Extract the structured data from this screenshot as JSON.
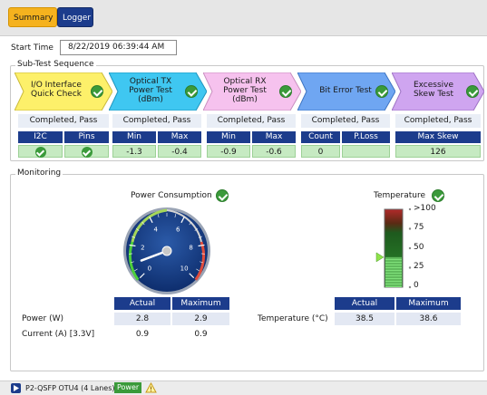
{
  "tabs": {
    "summary": "Summary",
    "logger": "Logger"
  },
  "start_time": {
    "label": "Start Time",
    "value": "8/22/2019 06:39:44 AM"
  },
  "subtest": {
    "title": "Sub-Test Sequence",
    "steps": [
      {
        "label_line1": "I/O Interface",
        "label_line2": "Quick Check",
        "label_line3": "",
        "color": "#fdf06a",
        "status": "Completed, Pass"
      },
      {
        "label_line1": "Optical TX",
        "label_line2": "Power Test",
        "label_line3": "(dBm)",
        "color": "#3fc7f1",
        "status": "Completed, Pass"
      },
      {
        "label_line1": "Optical RX",
        "label_line2": "Power Test",
        "label_line3": "(dBm)",
        "color": "#f6c2ee",
        "status": "Completed, Pass"
      },
      {
        "label_line1": "Bit Error Test",
        "label_line2": "",
        "label_line3": "",
        "color": "#6fa6f2",
        "status": "Completed, Pass"
      },
      {
        "label_line1": "Excessive",
        "label_line2": "Skew Test",
        "label_line3": "",
        "color": "#cfa5f0",
        "status": "Completed, Pass"
      }
    ],
    "headers": {
      "i2c": "I2C",
      "pins": "Pins",
      "tx_min": "Min",
      "tx_max": "Max",
      "rx_min": "Min",
      "rx_max": "Max",
      "count": "Count",
      "ploss": "P.Loss",
      "max_skew": "Max Skew"
    },
    "values": {
      "tx_min": "-1.3",
      "tx_max": "-0.4",
      "rx_min": "-0.9",
      "rx_max": "-0.6",
      "count": "0",
      "ploss": "",
      "max_skew": "126"
    }
  },
  "monitoring": {
    "title": "Monitoring",
    "power": {
      "title": "Power Consumption",
      "gauge_ticks": [
        "0",
        "2",
        "4",
        "6",
        "8",
        "10"
      ],
      "gauge_value": 0.9,
      "gauge_max": 10,
      "col_actual": "Actual",
      "col_maximum": "Maximum",
      "rows": [
        {
          "label": "Power (W)",
          "actual": "2.8",
          "maximum": "2.9"
        },
        {
          "label": "Current (A) [3.3V]",
          "actual": "0.9",
          "maximum": "0.9"
        }
      ]
    },
    "temperature": {
      "title": "Temperature",
      "scale": [
        ">100",
        "75",
        "50",
        "25",
        "0"
      ],
      "level_percent": 38.5,
      "col_actual": "Actual",
      "col_maximum": "Maximum",
      "row_label": "Temperature (°C)",
      "actual": "38.5",
      "maximum": "38.6"
    }
  },
  "statusbar": {
    "device": "P2-QSFP OTU4 (4 Lanes)",
    "power_badge": "Power"
  },
  "colors": {
    "navy": "#1c3c8c",
    "pass_green": "#3a9a3a",
    "value_green": "#c6eac2",
    "summary_tab": "#f5b21e"
  }
}
